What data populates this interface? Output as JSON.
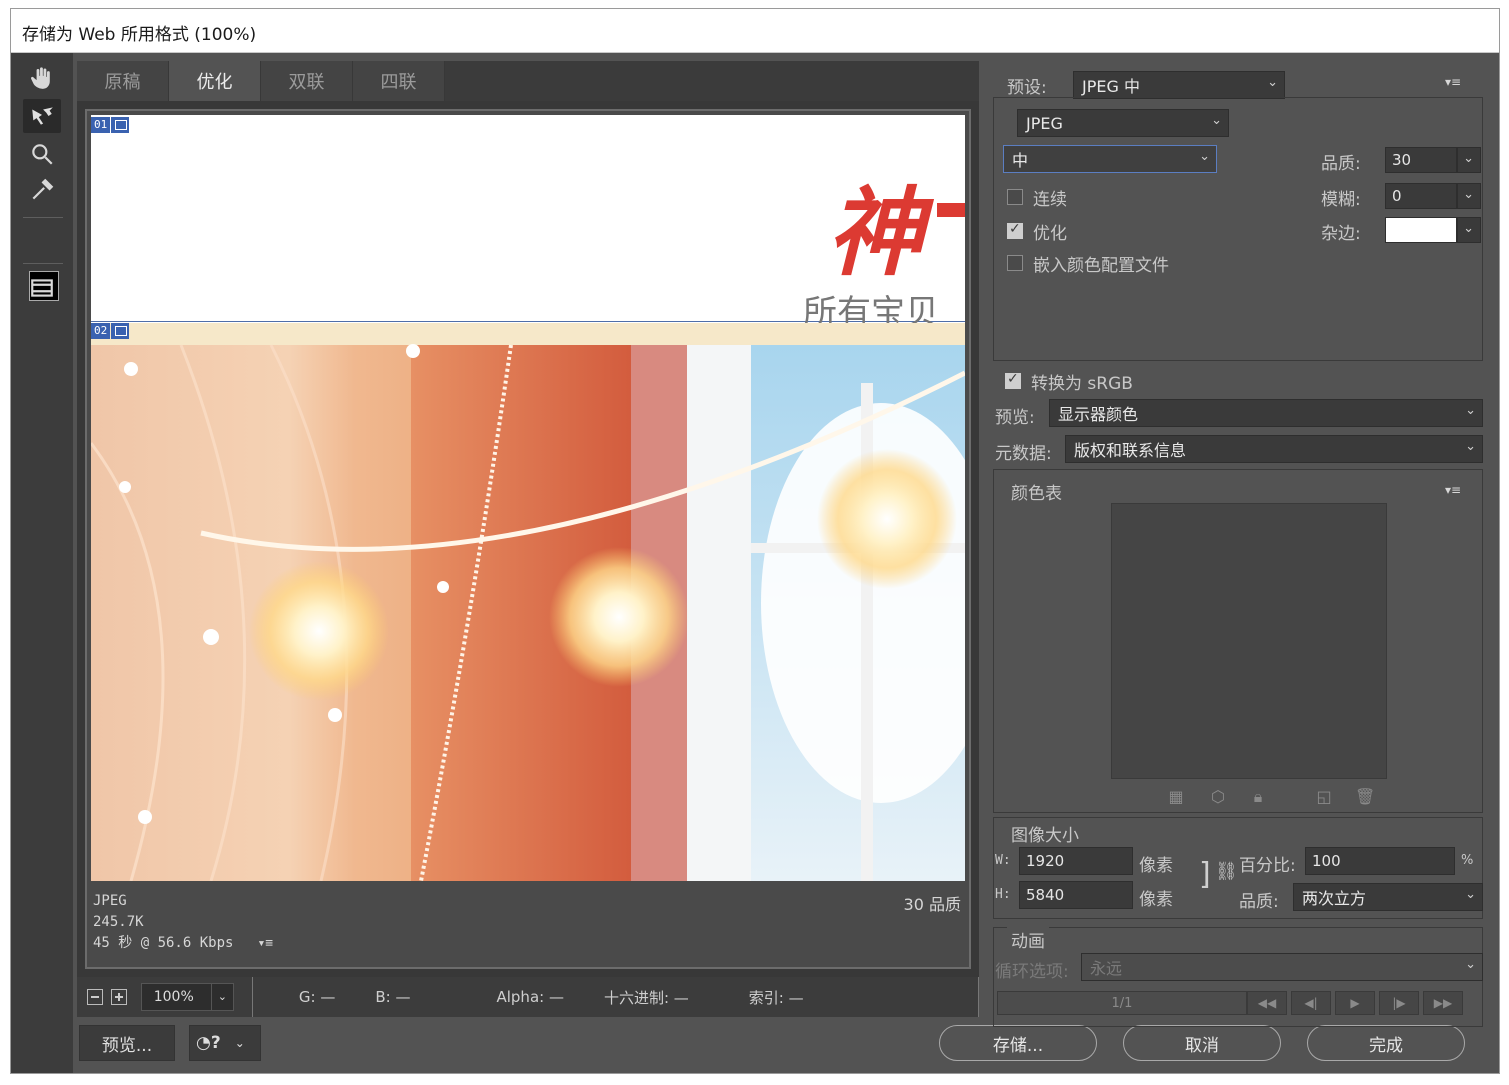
{
  "window": {
    "title": "存储为 Web 所用格式 (100%)"
  },
  "tools": [
    "hand-tool",
    "slice-select-tool",
    "zoom-tool",
    "eyedropper-tool",
    "eyedropper-color",
    "toggle-slices-visibility"
  ],
  "tabs": [
    {
      "label": "原稿",
      "active": false
    },
    {
      "label": "优化",
      "active": true
    },
    {
      "label": "双联",
      "active": false
    },
    {
      "label": "四联",
      "active": false
    }
  ],
  "canvas": {
    "slice1": {
      "number": "01",
      "title_text": "神",
      "subtitle_text": "所有宝贝"
    },
    "slice2": {
      "number": "02"
    },
    "info": {
      "format": "JPEG",
      "size": "245.7K",
      "time": "45 秒 @ 56.6 Kbps",
      "quality": "30 品质"
    }
  },
  "status": {
    "zoom": "100%",
    "g": "G: —",
    "b": "B: —",
    "alpha": "Alpha: —",
    "hex": "十六进制: —",
    "index": "索引: —"
  },
  "bottom": {
    "preview": "预览...",
    "save": "存储...",
    "cancel": "取消",
    "done": "完成"
  },
  "settings": {
    "preset_label": "预设:",
    "preset_value": "JPEG 中",
    "format_value": "JPEG",
    "quality_preset": "中",
    "quality_label": "品质:",
    "quality_value": "30",
    "blur_label": "模糊:",
    "blur_value": "0",
    "matte_label": "杂边:",
    "progressive_label": "连续",
    "progressive_checked": false,
    "optimized_label": "优化",
    "optimized_checked": true,
    "embed_label": "嵌入颜色配置文件",
    "embed_checked": false,
    "srgb_label": "转换为 sRGB",
    "srgb_checked": true,
    "preview_label": "预览:",
    "preview_value": "显示器颜色",
    "metadata_label": "元数据:",
    "metadata_value": "版权和联系信息"
  },
  "color_table": {
    "title": "颜色表"
  },
  "image_size": {
    "title": "图像大小",
    "w_label": "W:",
    "w_value": "1920",
    "h_label": "H:",
    "h_value": "5840",
    "unit": "像素",
    "percent_label": "百分比:",
    "percent_value": "100",
    "percent_unit": "%",
    "quality_label": "品质:",
    "quality_value": "两次立方"
  },
  "animation": {
    "title": "动画",
    "loop_label": "循环选项:",
    "loop_value": "永远",
    "frame_counter": "1/1"
  }
}
